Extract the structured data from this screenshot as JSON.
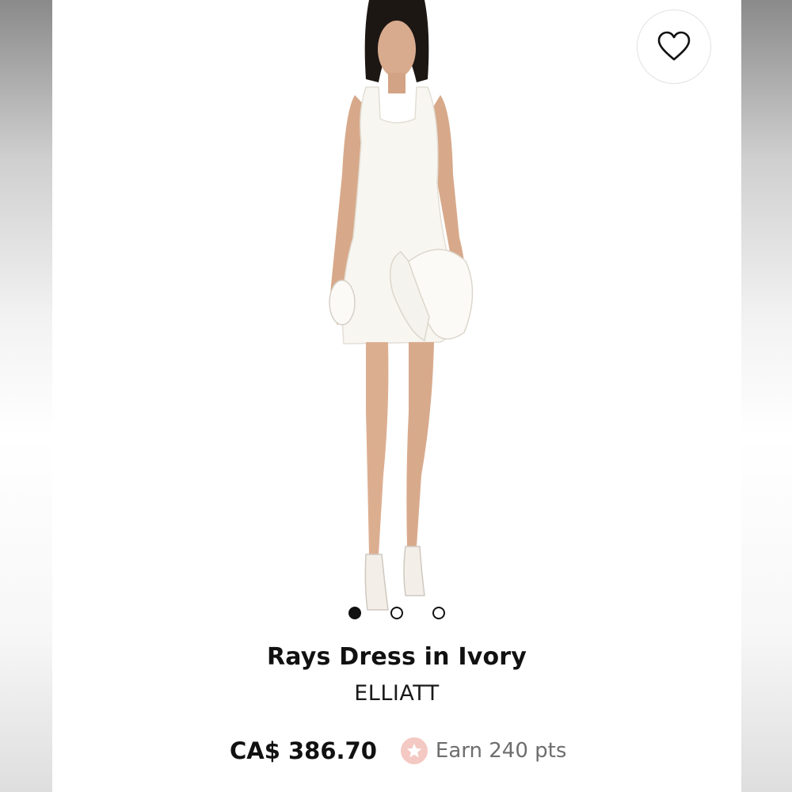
{
  "product": {
    "name": "Rays Dress in Ivory",
    "brand": "ELLIATT",
    "price": "CA$ 386.70",
    "rewards": "Earn 240 pts"
  },
  "gallery": {
    "image_count": 3,
    "active_index": 0
  },
  "icons": {
    "favorite": "heart-icon",
    "rewards": "star-icon"
  },
  "colors": {
    "badge": "#f4c9c3",
    "text": "#111111",
    "muted_text": "#6e6e6e"
  }
}
